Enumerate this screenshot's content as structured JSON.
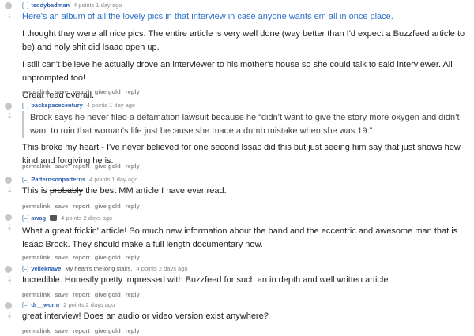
{
  "toggle": "[–]",
  "buttons": [
    "permalink",
    "save",
    "report",
    "give gold",
    "reply"
  ],
  "comments": [
    {
      "author": "teddybadman",
      "meta": "4 points 1 day ago",
      "link_text": "Here's an album of all the lovely pics in that interview in case anyone wants em all in once place.",
      "paragraphs": [
        "I thought they were all nice pics. The entire article is very well done (way better than I'd expect a Buzzfeed article to be) and holy shit did Isaac open up.",
        "I still can't believe he actually drove an interviewer to his mother's house so she could talk to said interviewer. All unprompted too!",
        "Great read overall."
      ]
    },
    {
      "author": "backspacecentury",
      "meta": "4 points 1 day ago",
      "quote": "Brock says he never filed a defamation lawsuit because he “didn’t want to give the story more oxygen and didn’t want to ruin that woman’s life just because she made a dumb mistake when she was 19.”",
      "paragraphs": [
        "This broke my heart - I've never believed for one second Issac did this but just seeing him say that just shows how kind and forgiving he is."
      ]
    },
    {
      "author": "Patternsonpatterns",
      "meta": "4 points 1 day ago",
      "text_pre": "This is ",
      "text_strike": "probably",
      "text_post": " the best MM article I have ever read."
    },
    {
      "author": "awag",
      "meta": "4 points 2 days ago",
      "paragraphs": [
        "What a great frickin' article! So much new information about the band and the eccentric and awesome man that is Isaac Brock. They should make a full length documentary now."
      ]
    },
    {
      "author": "yelleknave",
      "flair": "My heart's the long stairs.",
      "meta": "4 points 2 days ago",
      "paragraphs": [
        "Incredible. Honestly pretty impressed with Buzzfeed for such an in depth and well written article."
      ]
    },
    {
      "author": "dr__worm",
      "meta": "2 points 2 days ago",
      "paragraphs": [
        "great interview! Does an audio or video version exist anywhere?"
      ]
    }
  ]
}
